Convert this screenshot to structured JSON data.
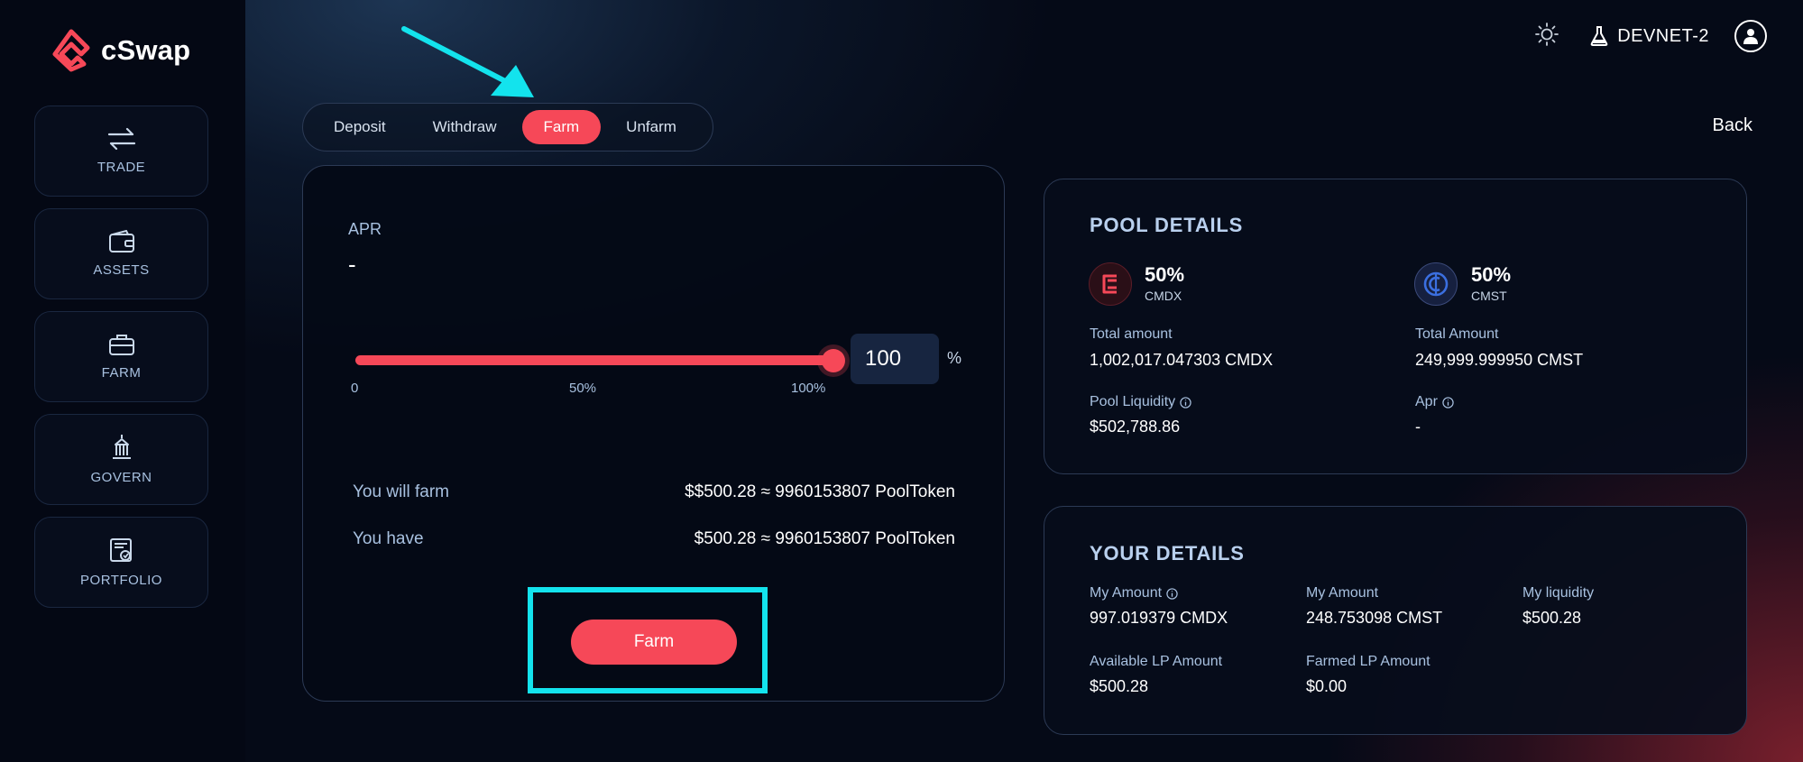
{
  "brand": {
    "name": "cSwap",
    "color": "#f64858"
  },
  "sidebar": {
    "items": [
      {
        "label": "TRADE",
        "icon": "swap-arrows-icon"
      },
      {
        "label": "ASSETS",
        "icon": "wallet-icon"
      },
      {
        "label": "FARM",
        "icon": "briefcase-icon"
      },
      {
        "label": "GOVERN",
        "icon": "bank-icon"
      },
      {
        "label": "PORTFOLIO",
        "icon": "portfolio-icon"
      }
    ]
  },
  "header": {
    "network": "DEVNET-2",
    "theme_icon": "sun-icon",
    "network_icon": "flask-icon",
    "profile_icon": "user-icon"
  },
  "tabs": [
    {
      "label": "Deposit",
      "active": false
    },
    {
      "label": "Withdraw",
      "active": false
    },
    {
      "label": "Farm",
      "active": true
    },
    {
      "label": "Unfarm",
      "active": false
    }
  ],
  "back_label": "Back",
  "farm_card": {
    "apr_label": "APR",
    "apr_value": "-",
    "slider": {
      "value": 100,
      "ticks": [
        "0",
        "50%",
        "100%"
      ],
      "unit": "%"
    },
    "percent_input": "100",
    "will_farm_label": "You will farm",
    "will_farm_value": "$$500.28 ≈ 9960153807 PoolToken",
    "have_label": "You have",
    "have_value": "$500.28 ≈ 9960153807 PoolToken",
    "button_label": "Farm"
  },
  "pool_details": {
    "title": "POOL DETAILS",
    "tokens": [
      {
        "share": "50%",
        "symbol": "CMDX",
        "color": "#f64858"
      },
      {
        "share": "50%",
        "symbol": "CMST",
        "color": "#3b6fe0"
      }
    ],
    "total_amount_cmdx_label": "Total amount",
    "total_amount_cmdx_value": "1,002,017.047303 CMDX",
    "total_amount_cmst_label": "Total Amount",
    "total_amount_cmst_value": "249,999.999950 CMST",
    "pool_liquidity_label": "Pool Liquidity",
    "pool_liquidity_value": "$502,788.86",
    "apr_label": "Apr",
    "apr_value": "-"
  },
  "your_details": {
    "title": "YOUR DETAILS",
    "my_amount_cmdx_label": "My Amount",
    "my_amount_cmdx_value": "997.019379 CMDX",
    "my_amount_cmst_label": "My Amount",
    "my_amount_cmst_value": "248.753098 CMST",
    "my_liquidity_label": "My liquidity",
    "my_liquidity_value": "$500.28",
    "available_lp_label": "Available LP Amount",
    "available_lp_value": "$500.28",
    "farmed_lp_label": "Farmed LP Amount",
    "farmed_lp_value": "$0.00"
  },
  "annotation_color": "#13e3ed"
}
